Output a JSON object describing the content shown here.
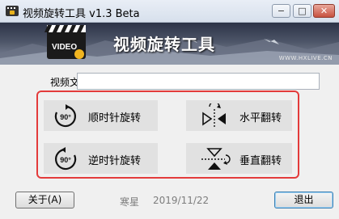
{
  "window": {
    "title": "视频旋转工具 v1.3 Beta",
    "controls": {
      "minimize": "−",
      "maximize": "□",
      "close": "✕"
    }
  },
  "banner": {
    "title": "视频旋转工具",
    "url": "WWW.HXLIVE.CN",
    "logo_text": "VIDEO"
  },
  "file": {
    "label": "视频文件:",
    "value": ""
  },
  "actions": {
    "rotate_cw": {
      "label": "顺时针旋转",
      "icon": "rotate-clockwise-90-icon",
      "icon_text": "90°"
    },
    "rotate_ccw": {
      "label": "逆时针旋转",
      "icon": "rotate-counterclockwise-90-icon",
      "icon_text": "90°"
    },
    "flip_horizontal": {
      "label": "水平翻转",
      "icon": "flip-horizontal-icon"
    },
    "flip_vertical": {
      "label": "垂直翻转",
      "icon": "flip-vertical-icon"
    }
  },
  "footer": {
    "about_label": "关于(A)",
    "author": "寒星",
    "date": "2019/11/22",
    "exit_label": "退出"
  },
  "colors": {
    "highlight": "#e33b3b",
    "button_face": "#e1e1e1"
  }
}
